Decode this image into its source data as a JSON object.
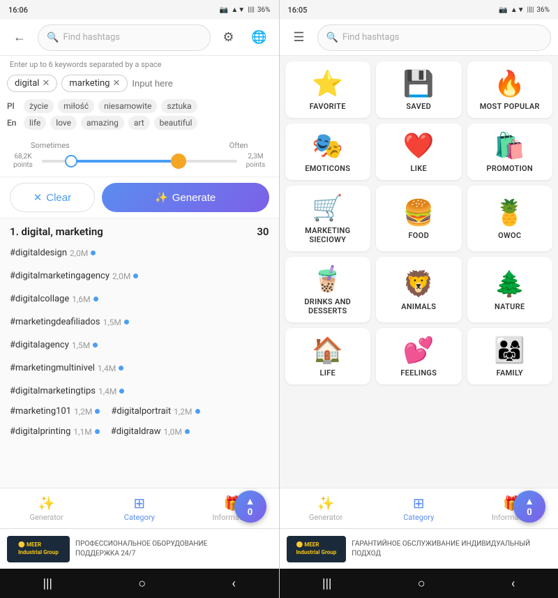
{
  "left": {
    "status": {
      "time": "16:06",
      "camera_icon": "📷",
      "network": "▲▼",
      "signal": "📶",
      "battery": "36%"
    },
    "nav": {
      "back_label": "←",
      "search_placeholder": "Find hashtags",
      "filter_icon": "⚙",
      "globe_icon": "🌐"
    },
    "keyword_hint": "Enter up to 6 keywords separated by a space",
    "tags": [
      {
        "label": "digital",
        "removable": true
      },
      {
        "label": "marketing",
        "removable": true
      }
    ],
    "input_placeholder": "Input here",
    "languages": {
      "pl": {
        "label": "Pl",
        "tags": [
          "życie",
          "miłość",
          "niesamowite",
          "sztuka"
        ]
      },
      "en": {
        "label": "En",
        "tags": [
          "life",
          "love",
          "amazing",
          "art",
          "beautiful"
        ]
      }
    },
    "slider": {
      "left_label": "Sometimes",
      "right_label": "Often",
      "min_label": "68,2K\npoints",
      "max_label": "2,3M\npoints"
    },
    "buttons": {
      "clear_label": "Clear",
      "clear_icon": "✕",
      "generate_label": "Generate",
      "generate_icon": "✨"
    },
    "results": {
      "title": "1. digital, marketing",
      "count": "30",
      "hashtags": [
        {
          "tag": "#digitaldesign",
          "count": "2,0M"
        },
        {
          "tag": "#digitalmarketingagency",
          "count": "2,0M"
        },
        {
          "tag": "#digitalcollage",
          "count": "1,6M"
        },
        {
          "tag": "#marketingdeafiliados",
          "count": "1,5M"
        },
        {
          "tag": "#digitalagency",
          "count": "1,5M"
        },
        {
          "tag": "#marketingmultinivel",
          "count": "1,4M"
        },
        {
          "tag": "#digitalmarketingtips",
          "count": "1,4M"
        },
        {
          "tag": "#marketing101",
          "count": "1,2M"
        },
        {
          "tag": "#digitalportrait",
          "count": "1,2M"
        },
        {
          "tag": "#digitalprinting",
          "count": "1,1M"
        },
        {
          "tag": "#digitaldraw",
          "count": "1,0M"
        }
      ]
    },
    "bottom_nav": [
      {
        "icon": "✨",
        "label": "Generator",
        "active": false
      },
      {
        "icon": "⊞",
        "label": "Category",
        "active": true
      },
      {
        "icon": "🎁",
        "label": "Information",
        "active": false
      }
    ],
    "fab": {
      "arrow": "▲",
      "count": "0"
    },
    "ad": {
      "logo": "MEER\nIndustrial Group",
      "text": "ПРОФЕССИОНАЛЬНОЕ ОБОРУДОВАНИЕ\nПОДДЕРЖКА 24/7"
    }
  },
  "right": {
    "status": {
      "time": "16:05",
      "camera_icon": "📷",
      "network": "▲▼",
      "signal": "📶",
      "battery": "36%"
    },
    "nav": {
      "menu_icon": "☰",
      "search_placeholder": "Find hashtags"
    },
    "categories": [
      {
        "emoji": "⭐",
        "label": "FAVORITE"
      },
      {
        "emoji": "💾",
        "label": "SAVED"
      },
      {
        "emoji": "🔥",
        "label": "MOST POPULAR"
      },
      {
        "emoji": "🎭",
        "label": "EMOTICONS"
      },
      {
        "emoji": "❤️",
        "label": "LIKE"
      },
      {
        "emoji": "🛍️",
        "label": "PROMOTION"
      },
      {
        "emoji": "🛒",
        "label": "MARKETING SIECIOWY"
      },
      {
        "emoji": "🍔",
        "label": "FOOD"
      },
      {
        "emoji": "🍍",
        "label": "OWOC"
      },
      {
        "emoji": "🧋",
        "label": "DRINKS AND DESSERTS"
      },
      {
        "emoji": "🦁",
        "label": "ANIMALS"
      },
      {
        "emoji": "🌲",
        "label": "NATURE"
      },
      {
        "emoji": "🏠",
        "label": "LIFE"
      },
      {
        "emoji": "💕",
        "label": "FEELINGS"
      },
      {
        "emoji": "👨‍👩‍👧",
        "label": "FAMILY"
      }
    ],
    "bottom_nav": [
      {
        "icon": "✨",
        "label": "Generator",
        "active": false
      },
      {
        "icon": "⊞",
        "label": "Category",
        "active": true
      },
      {
        "icon": "🎁",
        "label": "Information",
        "active": false
      }
    ],
    "fab": {
      "arrow": "▲",
      "count": "0"
    },
    "ad": {
      "logo": "MEER\nIndustrial Group",
      "text": "ГАРАНТИЙНОЕ ОБСЛУЖИВАНИЕ\nИНДИВИДУАЛЬНЫЙ ПОДХОД"
    }
  }
}
